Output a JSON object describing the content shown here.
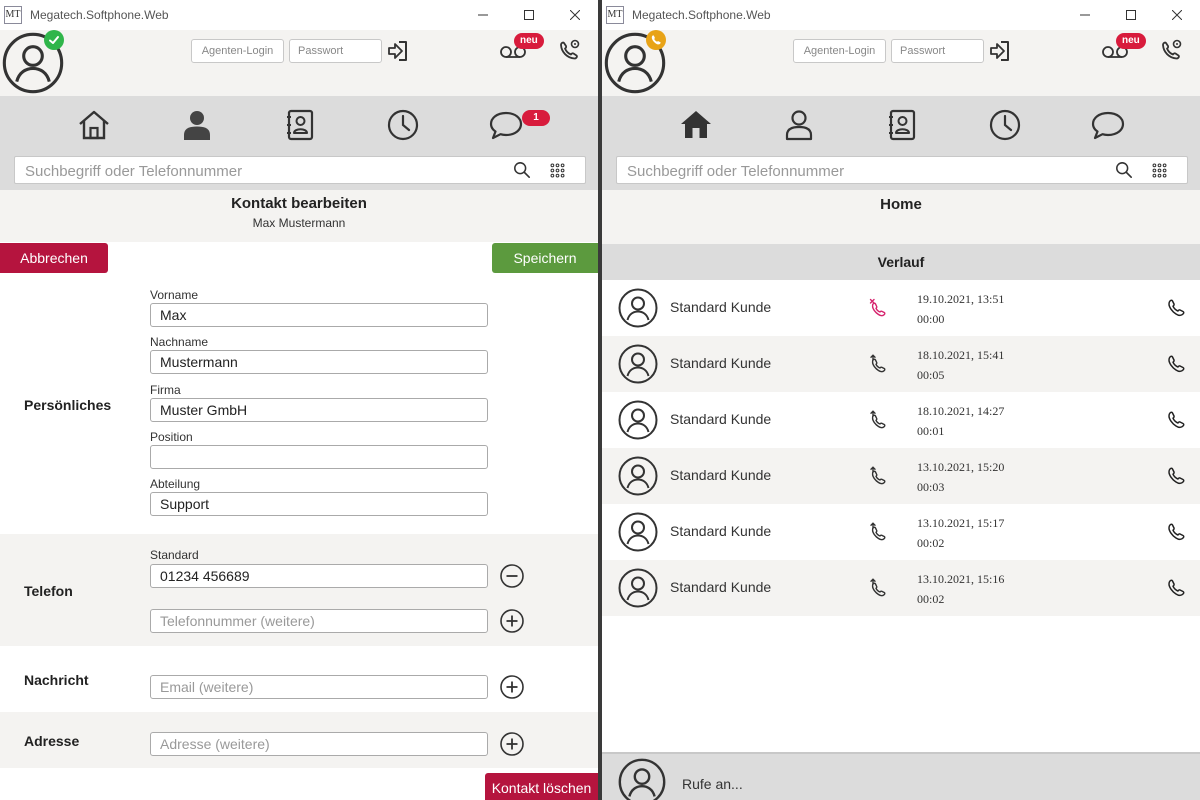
{
  "colors": {
    "header_bg": "#f4f3f1",
    "nav_bg": "#dcdcdc",
    "cancel_red": "#b5143e",
    "save_green": "#5c9a3e",
    "badge_red": "#d81b3c",
    "status_online": "#2fb54a",
    "status_calling": "#e8a317",
    "missed_call_pink": "#d6246e"
  },
  "left": {
    "window": {
      "logo": "MT",
      "title": "Megatech.Softphone.Web"
    },
    "header": {
      "status": "online",
      "agent_login": "Agenten-Login",
      "password": "Passwort",
      "badge_neu": "neu"
    },
    "nav": {
      "messages_badge": "1",
      "active": "contact"
    },
    "search": {
      "placeholder": "Suchbegriff oder Telefonnummer"
    },
    "page": {
      "title": "Kontakt bearbeiten",
      "subtitle": "Max Mustermann"
    },
    "actions": {
      "cancel": "Abbrechen",
      "save": "Speichern",
      "delete": "Kontakt löschen"
    },
    "personal": {
      "section_label": "Persönliches",
      "firstname_label": "Vorname",
      "firstname_value": "Max",
      "lastname_label": "Nachname",
      "lastname_value": "Mustermann",
      "company_label": "Firma",
      "company_value": "Muster GmbH",
      "position_label": "Position",
      "position_value": "",
      "department_label": "Abteilung",
      "department_value": "Support"
    },
    "phone": {
      "section_label": "Telefon",
      "standard_label": "Standard",
      "standard_value": "01234 456689",
      "more_placeholder": "Telefonnummer (weitere)"
    },
    "message": {
      "section_label": "Nachricht",
      "email_placeholder": "Email (weitere)"
    },
    "address": {
      "section_label": "Adresse",
      "address_placeholder": "Adresse (weitere)"
    }
  },
  "right": {
    "window": {
      "logo": "MT",
      "title": "Megatech.Softphone.Web"
    },
    "header": {
      "status": "calling",
      "agent_login": "Agenten-Login",
      "password": "Passwort",
      "badge_neu": "neu"
    },
    "nav": {
      "active": "home"
    },
    "search": {
      "placeholder": "Suchbegriff oder Telefonnummer"
    },
    "page": {
      "title": "Home"
    },
    "history": {
      "heading": "Verlauf",
      "rows": [
        {
          "name": "Standard Kunde",
          "type": "missed",
          "date": "19.10.2021, 13:51",
          "duration": "00:00"
        },
        {
          "name": "Standard Kunde",
          "type": "outgoing",
          "date": "18.10.2021, 15:41",
          "duration": "00:05"
        },
        {
          "name": "Standard Kunde",
          "type": "outgoing",
          "date": "18.10.2021, 14:27",
          "duration": "00:01"
        },
        {
          "name": "Standard Kunde",
          "type": "outgoing",
          "date": "13.10.2021, 15:20",
          "duration": "00:03"
        },
        {
          "name": "Standard Kunde",
          "type": "outgoing",
          "date": "13.10.2021, 15:17",
          "duration": "00:02"
        },
        {
          "name": "Standard Kunde",
          "type": "outgoing",
          "date": "13.10.2021, 15:16",
          "duration": "00:02"
        }
      ]
    },
    "footer": {
      "text": "Rufe an..."
    }
  }
}
